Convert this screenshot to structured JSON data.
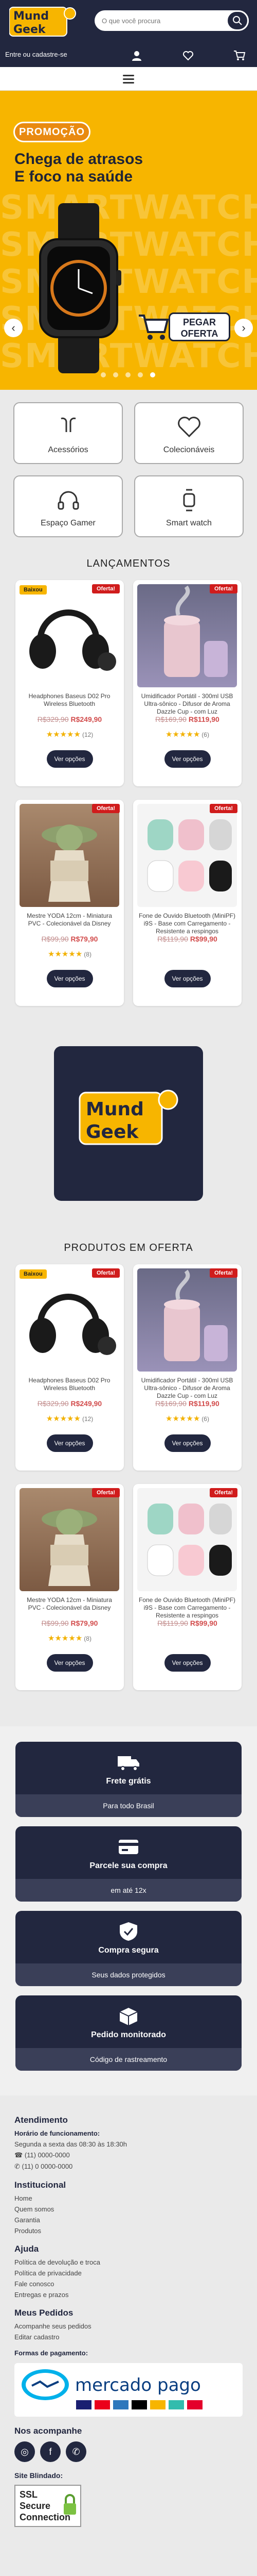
{
  "header": {
    "logo_line1": "Mund",
    "logo_line2": "Geek",
    "search_placeholder": "O que você procura",
    "login_text": "Entre ou cadastre-se"
  },
  "banner": {
    "badge": "PROMOÇÃO",
    "title_line1": "Chega de atrasos",
    "title_line2": "E foco na saúde",
    "bg_word": "SMARTWATCH",
    "cta_line1": "PEGAR",
    "cta_line2": "OFERTA"
  },
  "categories": [
    {
      "label": "Acessórios",
      "icon": "earbuds-icon"
    },
    {
      "label": "Colecionáveis",
      "icon": "heart-icon"
    },
    {
      "label": "Espaço Gamer",
      "icon": "headset-icon"
    },
    {
      "label": "Smart watch",
      "icon": "watch-icon"
    }
  ],
  "section1_title": "LANÇAMENTOS",
  "section2_title": "PRODUTOS EM OFERTA",
  "products": [
    {
      "name": "Headphones Baseus D02 Pro Wireless Bluetooth",
      "old": "R$329,90",
      "new": "R$249,90",
      "stars": "★★★★★",
      "count": "(12)",
      "offer": "Oferta!",
      "new_tag": "Baixou",
      "button": "Ver opções"
    },
    {
      "name": "Umidificador Portátil - 300ml USB Ultra-sônico - Difusor de Aroma Dazzle Cup - com Luz",
      "old": "R$169,90",
      "new": "R$119,90",
      "stars": "★★★★★",
      "count": "(6)",
      "offer": "Oferta!",
      "new_tag": "",
      "button": "Ver opções"
    },
    {
      "name": "Mestre YODA 12cm - Miniatura PVC - Colecionável da Disney",
      "old": "R$99,90",
      "new": "R$79,90",
      "stars": "★★★★★",
      "count": "(8)",
      "offer": "Oferta!",
      "new_tag": "",
      "button": "Ver opções"
    },
    {
      "name": "Fone de Ouvido Bluetooth (MiniPF) i9S - Base com Carregamento - Resistente a respingos",
      "old": "R$119,90",
      "new": "R$99,90",
      "stars": "",
      "count": "",
      "offer": "Oferta!",
      "new_tag": "",
      "button": "Ver opções"
    }
  ],
  "benefits": [
    {
      "title": "Frete grátis",
      "sub": "Para todo Brasil",
      "icon": "truck-icon"
    },
    {
      "title": "Parcele sua compra",
      "sub": "em até 12x",
      "icon": "card-icon"
    },
    {
      "title": "Compra segura",
      "sub": "Seus dados protegidos",
      "icon": "shield-icon"
    },
    {
      "title": "Pedido monitorado",
      "sub": "Código de rastreamento",
      "icon": "box-icon"
    }
  ],
  "footer": {
    "atendimento": "Atendimento",
    "horario_label": "Horário de funcionamento:",
    "horario": "Segunda a sexta das 08:30 às 18:30h",
    "phone1": "(11) 0000-0000",
    "phone2": "(11) 0 0000-0000",
    "institucional": "Institucional",
    "inst_links": [
      "Home",
      "Quem somos",
      "Garantia",
      "Produtos"
    ],
    "ajuda": "Ajuda",
    "ajuda_links": [
      "Política de devolução e troca",
      "Política de privacidade",
      "Fale conosco",
      "Entregas e prazos"
    ],
    "meus_pedidos": "Meus Pedidos",
    "pedidos_links": [
      "Acompanhe seus pedidos",
      "Editar cadastro"
    ],
    "formas": "Formas de pagamento:",
    "mp_logo": "mercado pago",
    "siga": "Nos acompanhe",
    "site_blindado": "Site Blindado:",
    "ssl_line1": "SSL",
    "ssl_line2": "Secure",
    "ssl_line3": "Connection"
  },
  "colors": {
    "navy": "#22273f",
    "yellow": "#f7b500",
    "red": "#d01c1c"
  }
}
